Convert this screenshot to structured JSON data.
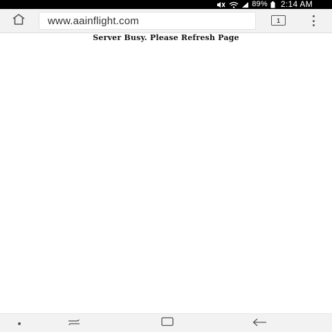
{
  "status_bar": {
    "battery_percent": "89%",
    "time": "2:14 AM",
    "icons": [
      "mute-icon",
      "wifi-icon",
      "signal-icon",
      "battery-icon"
    ]
  },
  "browser": {
    "url": "www.aainflight.com",
    "tab_count": "1",
    "icons": [
      "home-icon",
      "tabs-icon",
      "overflow-menu-icon"
    ]
  },
  "page": {
    "message": "Server Busy. Please Refresh Page"
  },
  "nav_bar": {
    "icons": [
      "nav-dot-icon",
      "recent-apps-icon",
      "home-button-icon",
      "back-arrow-icon"
    ]
  }
}
